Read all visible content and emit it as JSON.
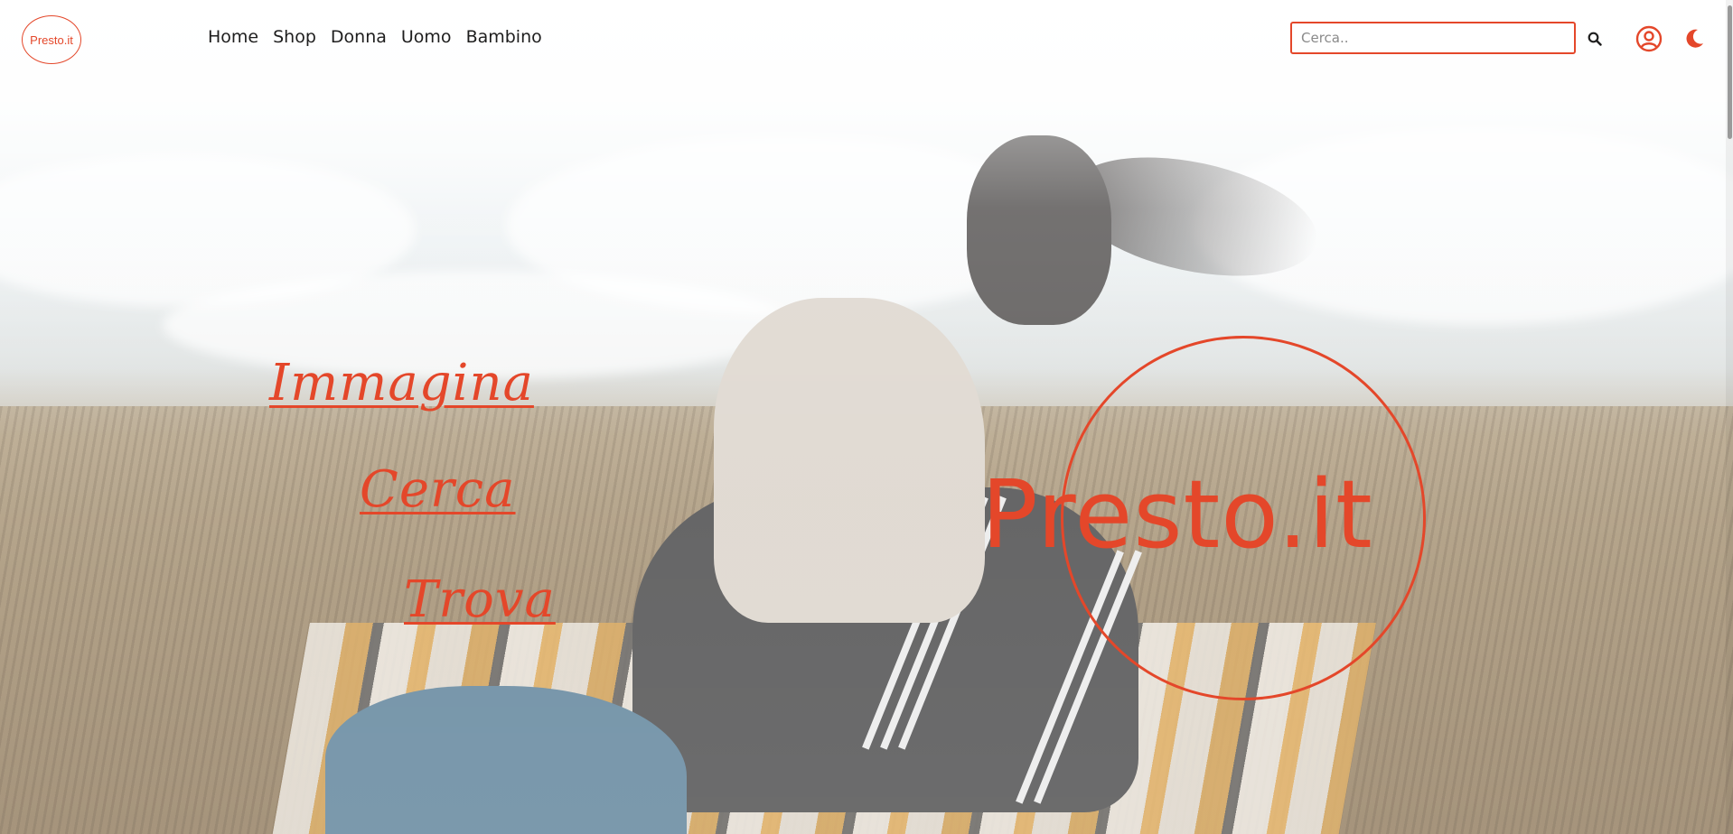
{
  "navbar": {
    "brand_label": "Presto.it",
    "links": [
      {
        "label": "Home"
      },
      {
        "label": "Shop"
      },
      {
        "label": "Donna"
      },
      {
        "label": "Uomo"
      },
      {
        "label": "Bambino"
      }
    ],
    "search": {
      "placeholder": "Cerca..",
      "value": "",
      "icon": "search-icon"
    },
    "user_icon": "user-circle-icon",
    "theme_icon": "moon-icon"
  },
  "hero": {
    "words": [
      "Immagina",
      "Cerca",
      "Trova"
    ],
    "title": "Presto.it"
  },
  "colors": {
    "accent": "#e4472a",
    "text": "#1e1e1e"
  }
}
